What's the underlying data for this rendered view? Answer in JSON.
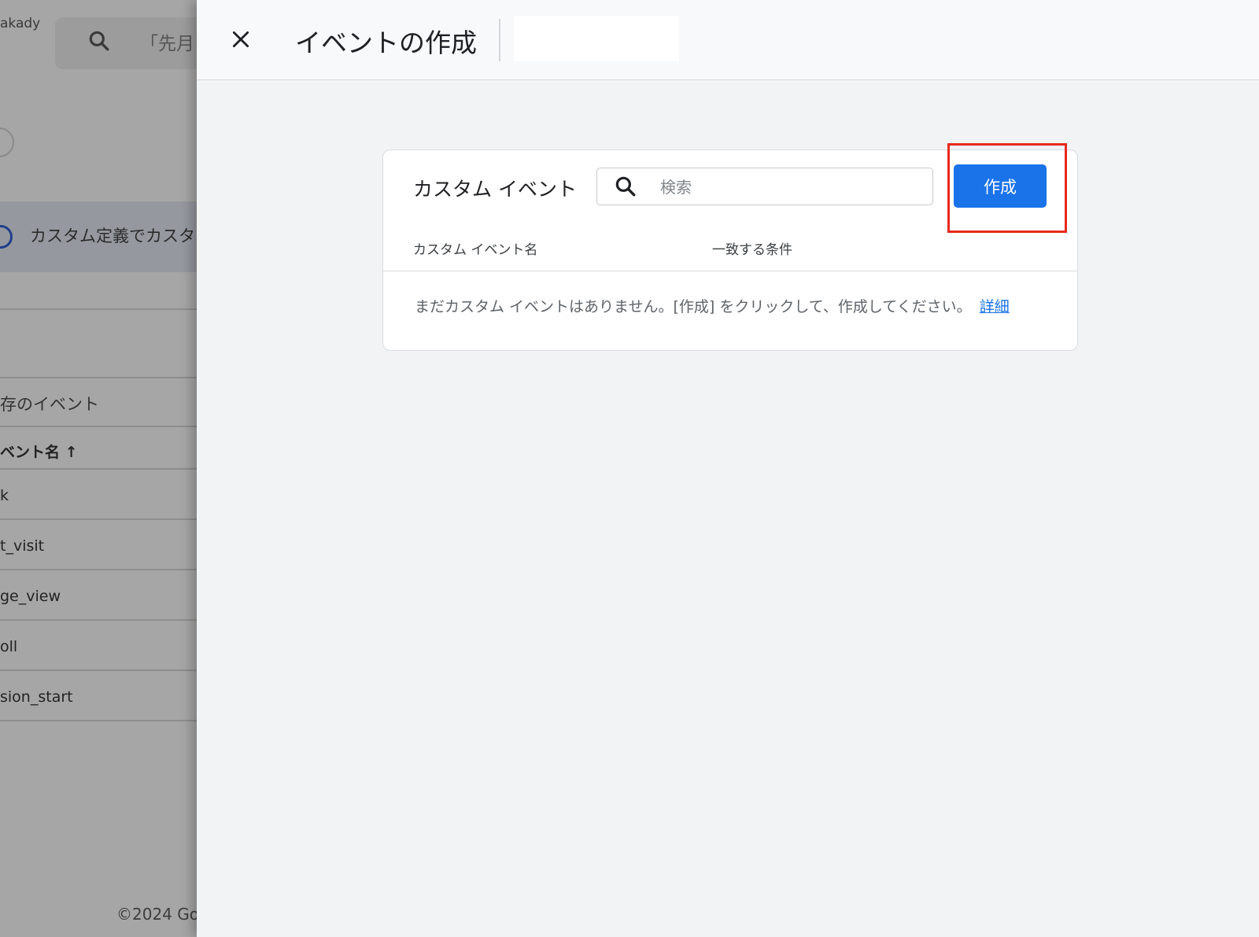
{
  "background_page": {
    "account_name": "akady",
    "search_text": "「先月",
    "banner_text": "カスタム定義でカスタ",
    "section_title": "存のイベント",
    "column_header": "ベント名 ↑",
    "rows": [
      "k",
      "t_visit",
      "ge_view",
      "oll",
      "sion_start"
    ],
    "footer": "©2024 Go"
  },
  "drawer": {
    "title": "イベントの作成",
    "card": {
      "title": "カスタム イベント",
      "search_placeholder": "検索",
      "create_label": "作成",
      "columns": [
        "カスタム イベント名",
        "一致する条件"
      ],
      "empty_message": "まだカスタム イベントはありません。[作成] をクリックして、作成してください。",
      "learn_more": "詳細"
    }
  },
  "colors": {
    "primary_button": "#1a73e8",
    "highlight": "#e8291c"
  }
}
